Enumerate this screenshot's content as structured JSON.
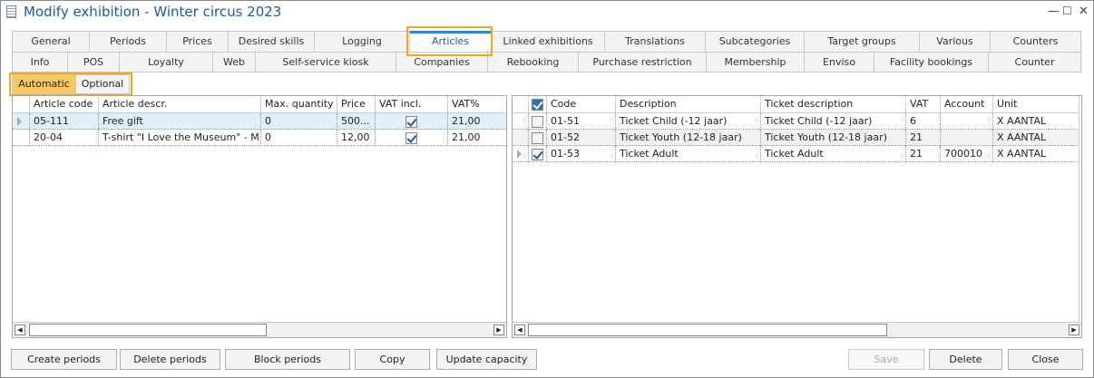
{
  "window": {
    "title": "Modify exhibition - Winter circus 2023",
    "minimize": "—",
    "maximize": "☐",
    "close": "✕"
  },
  "tabs_row1": [
    "General",
    "Periods",
    "Prices",
    "Desired skills",
    "Logging",
    "Articles",
    "Linked exhibitions",
    "Translations",
    "Subcategories",
    "Target groups",
    "Various",
    "Counters"
  ],
  "tabs_row2": [
    "Info",
    "POS",
    "Loyalty",
    "Web",
    "Self-service kiosk",
    "Companies",
    "Rebooking",
    "Purchase restriction",
    "Membership",
    "Enviso",
    "Facility bookings",
    "Counter"
  ],
  "active_tab": "Articles",
  "subtabs": [
    "Automatic",
    "Optional"
  ],
  "active_subtab": "Automatic",
  "articles": {
    "columns": [
      "Article code",
      "Article descr.",
      "Max. quantity",
      "Price",
      "VAT incl.",
      "VAT%"
    ],
    "rows": [
      [
        "05-111",
        "Free gift",
        "0",
        "500...",
        true,
        "21,00"
      ],
      [
        "20-04",
        "T-shirt \"I Love the Museum\" - M",
        "0",
        "12,00",
        true,
        "21,00"
      ]
    ]
  },
  "tickets": {
    "columns": [
      "Code",
      "Description",
      "Ticket description",
      "VAT",
      "Account",
      "Unit"
    ],
    "header_checked": true,
    "rows": [
      {
        "checked": false,
        "cells": [
          "01-51",
          "Ticket Child (-12 jaar)",
          "Ticket Child (-12 jaar)",
          "6",
          "",
          "X AANTAL"
        ]
      },
      {
        "checked": false,
        "cells": [
          "01-52",
          "Ticket Youth (12-18 jaar)",
          "Ticket Youth (12-18 jaar)",
          "21",
          "",
          "X AANTAL"
        ]
      },
      {
        "checked": true,
        "cells": [
          "01-53",
          "Ticket Adult",
          "Ticket Adult",
          "21",
          "700010",
          "X AANTAL"
        ]
      }
    ]
  },
  "buttons": {
    "create_periods": "Create periods",
    "delete_periods": "Delete periods",
    "block_periods": "Block periods",
    "copy": "Copy",
    "update_capacity": "Update capacity",
    "save": "Save",
    "delete": "Delete",
    "close": "Close"
  },
  "colors": {
    "highlight": "#f3a81a",
    "active_tab_accent": "#1e90d8",
    "title": "#1a5aa6"
  }
}
